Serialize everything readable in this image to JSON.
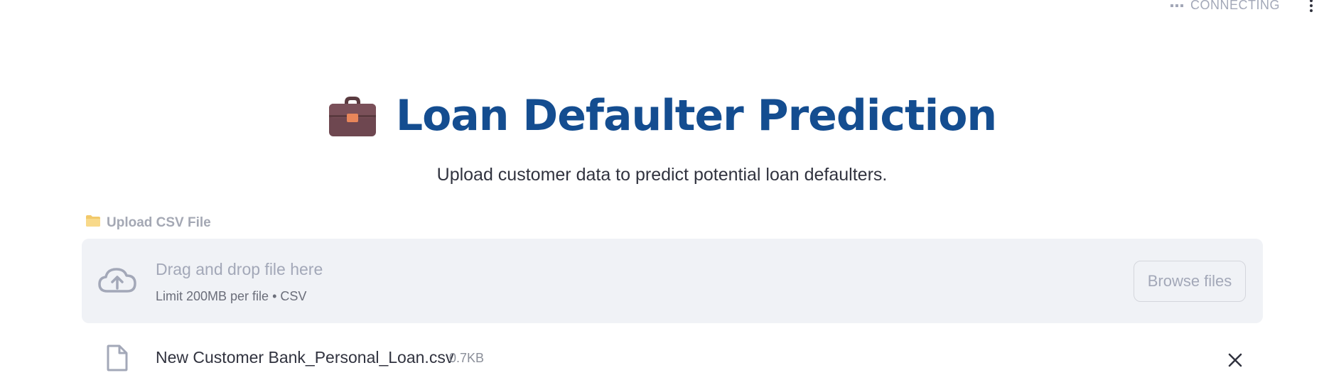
{
  "status": {
    "text": "CONNECTING"
  },
  "header": {
    "title": "Loan Defaulter Prediction",
    "title_icon": "briefcase-icon",
    "subtitle": "Upload customer data to predict potential loan defaulters."
  },
  "uploader": {
    "label": "Upload CSV File",
    "label_icon": "folder-icon",
    "dropzone_title": "Drag and drop file here",
    "dropzone_limit": "Limit 200MB per file • CSV",
    "browse_label": "Browse files"
  },
  "file": {
    "name": "New Customer Bank_Personal_Loan.csv",
    "size": "0.7KB"
  },
  "colors": {
    "title": "#144d90",
    "dropzone_bg": "#f0f2f6",
    "muted": "#a3a8b8"
  }
}
